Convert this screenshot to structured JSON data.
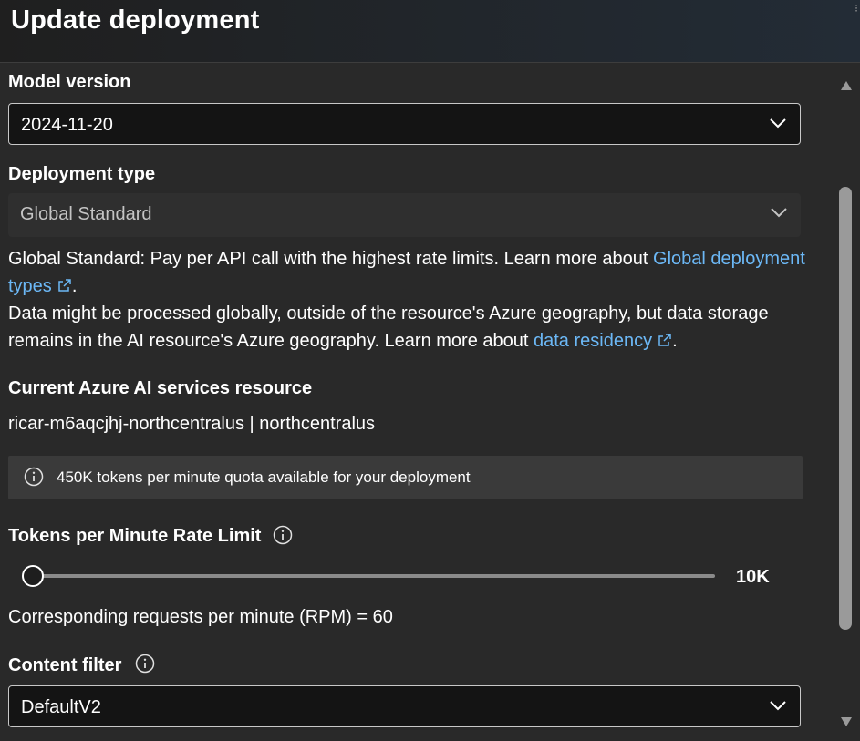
{
  "header": {
    "title": "Update deployment",
    "corner_mark": "⁝"
  },
  "model_version": {
    "label": "Model version",
    "value": "2024-11-20"
  },
  "deployment_type": {
    "label": "Deployment type",
    "value": "Global Standard",
    "desc_part1": "Global Standard: Pay per API call with the highest rate limits. Learn more about ",
    "desc_link1": "Global deployment types",
    "desc_part2": ".",
    "desc_part3": "Data might be processed globally, outside of the resource's Azure geography, but data storage remains in the AI resource's Azure geography. Learn more about ",
    "desc_link2": "data residency",
    "desc_part4": "."
  },
  "resource": {
    "label": "Current Azure AI services resource",
    "value": "ricar-m6aqcjhj-northcentralus | northcentralus"
  },
  "quota_info": {
    "message": "450K tokens per minute quota available for your deployment",
    "icon": "info-icon"
  },
  "rate_limit": {
    "label": "Tokens per Minute Rate Limit",
    "slider_value": "10K",
    "rpm_text": "Corresponding requests per minute (RPM) = 60"
  },
  "content_filter": {
    "label": "Content filter",
    "value": "DefaultV2"
  },
  "colors": {
    "background": "#292929",
    "link": "#6cb8f6",
    "infobar": "#3a3a3a"
  }
}
